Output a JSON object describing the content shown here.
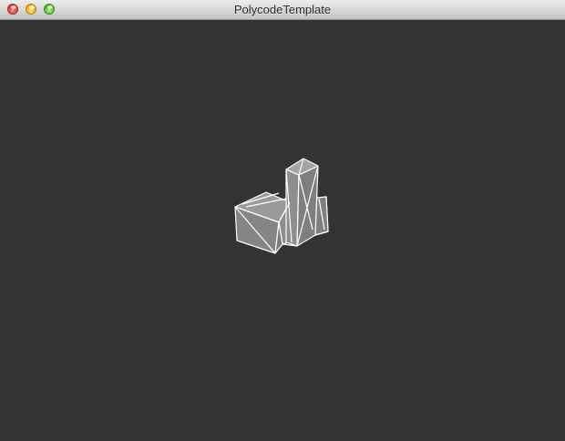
{
  "window": {
    "title": "PolycodeTemplate"
  },
  "icons": {
    "close": "close-button-icon",
    "minimize": "minimize-button-icon",
    "zoom": "zoom-button-icon"
  },
  "colors": {
    "viewport_background": "#333333",
    "mesh_fill": "#8a8a8a",
    "mesh_wire": "#ffffff"
  }
}
